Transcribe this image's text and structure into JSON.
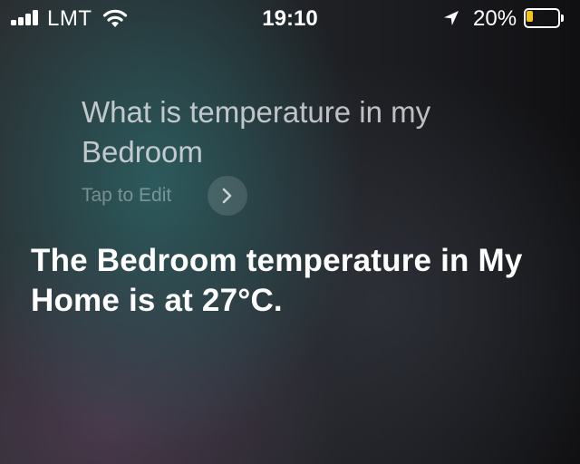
{
  "status_bar": {
    "carrier": "LMT",
    "time": "19:10",
    "battery_percent": "20%",
    "battery_level": 0.2,
    "battery_color": "#f5c518",
    "signal_bars": 4,
    "icons": [
      "signal-icon",
      "wifi-icon",
      "location-arrow-icon",
      "battery-icon"
    ]
  },
  "siri": {
    "query": "What is temperature in my Bedroom",
    "tap_to_edit": "Tap to Edit",
    "edit_icon": "chevron-right-icon",
    "response": "The Bedroom temperature in My Home is at 27°C."
  }
}
